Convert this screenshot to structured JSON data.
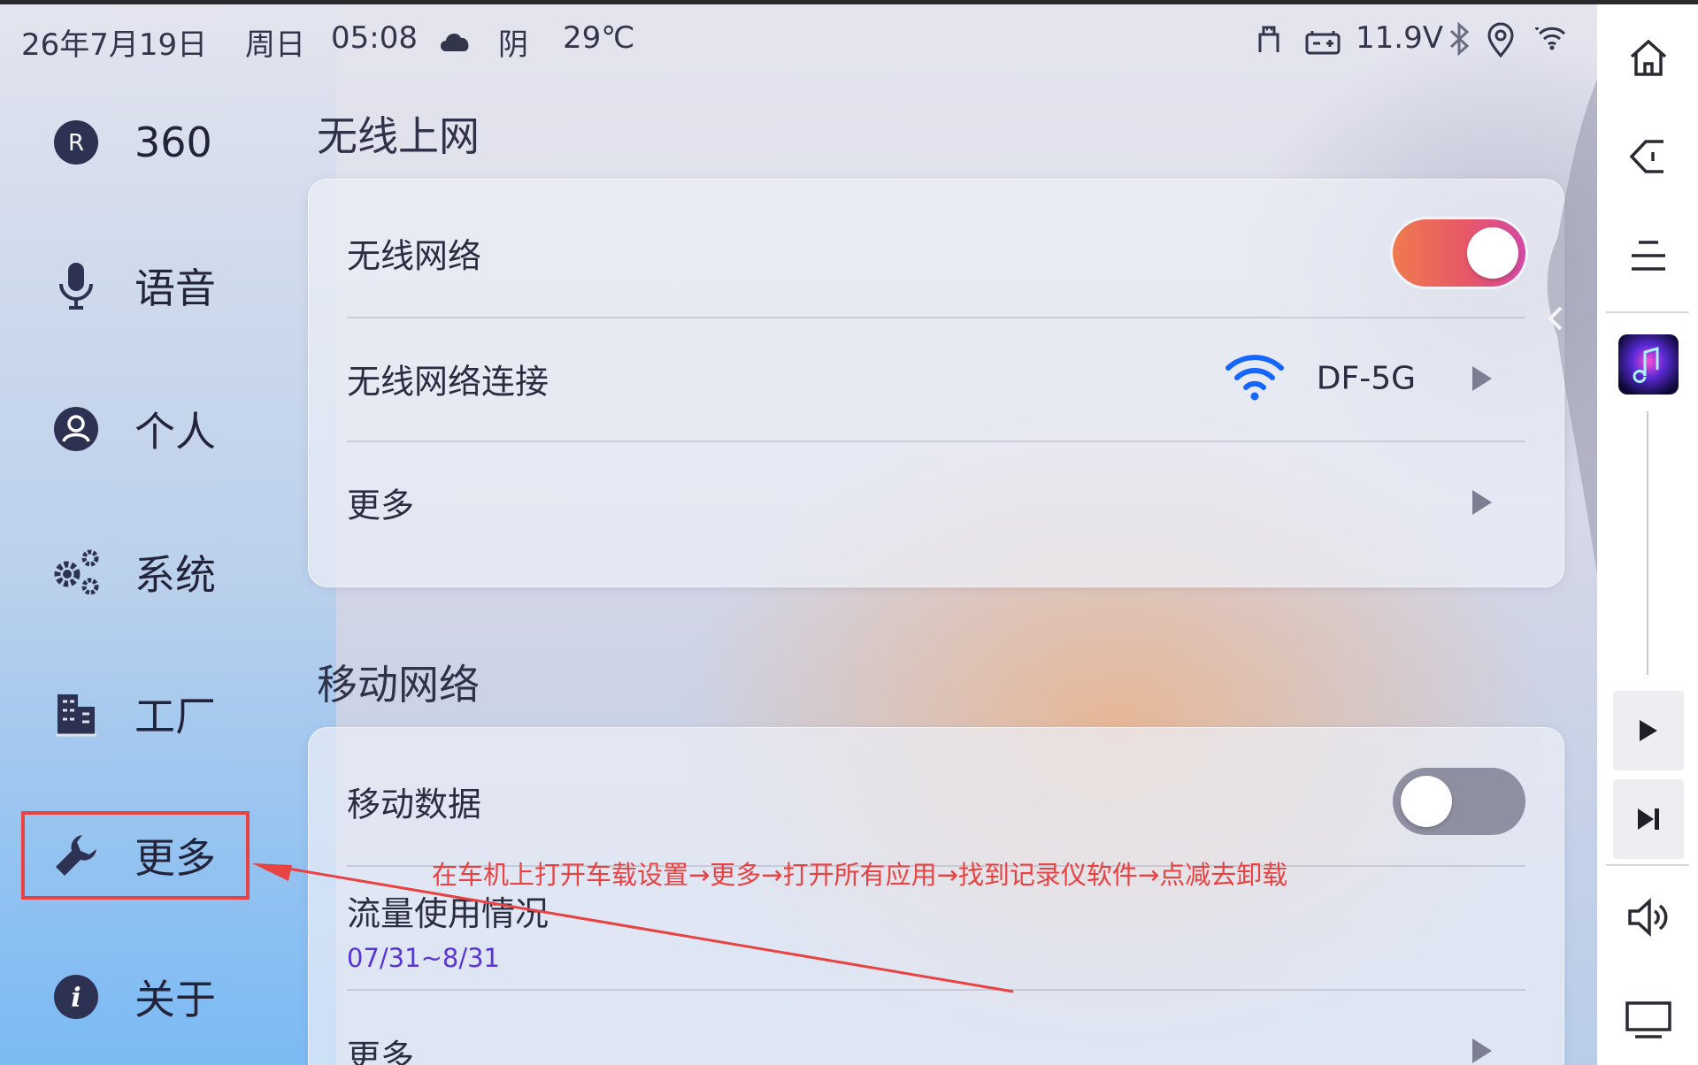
{
  "status_bar": {
    "date": "26年7月19日",
    "weekday": "周日",
    "time": "05:08",
    "weather": "阴",
    "temperature": "29℃",
    "voltage": "11.9V"
  },
  "sidebar": {
    "items": [
      {
        "label": "360",
        "icon": "r-circle-icon"
      },
      {
        "label": "语音",
        "icon": "microphone-icon"
      },
      {
        "label": "个人",
        "icon": "person-icon"
      },
      {
        "label": "系统",
        "icon": "gears-icon"
      },
      {
        "label": "工厂",
        "icon": "building-icon"
      },
      {
        "label": "更多",
        "icon": "wrench-icon",
        "selected": true
      },
      {
        "label": "关于",
        "icon": "info-icon"
      }
    ]
  },
  "wireless_section": {
    "title": "无线上网",
    "wifi_label": "无线网络",
    "wifi_enabled": true,
    "connection_label": "无线网络连接",
    "ssid": "DF-5G",
    "more_label": "更多"
  },
  "mobile_section": {
    "title": "移动网络",
    "data_label": "移动数据",
    "data_enabled": false,
    "usage_label": "流量使用情况",
    "usage_period": "07/31~8/31",
    "more_label": "更多"
  },
  "annotation": {
    "text": "在车机上打开车载设置→更多→打开所有应用→找到记录仪软件→点减去卸载",
    "color": "#e84242"
  },
  "colors": {
    "accent": "#e85866",
    "wifi_icon": "#1565ff",
    "usage_period": "#5a34d6"
  }
}
